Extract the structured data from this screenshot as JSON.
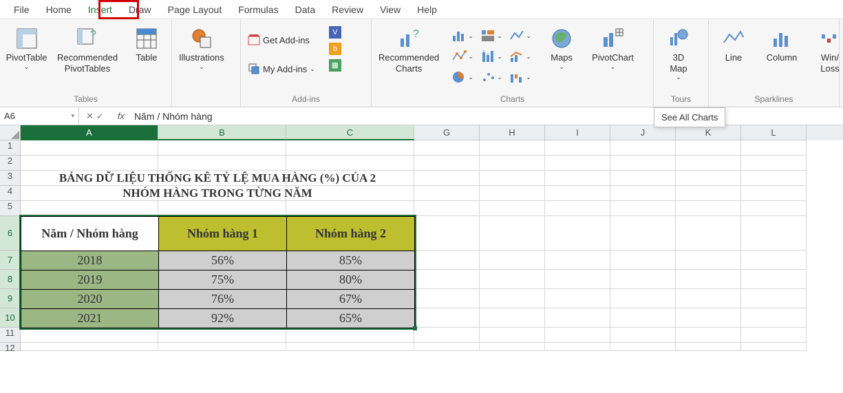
{
  "tabs": {
    "file": "File",
    "home": "Home",
    "insert": "Insert",
    "draw": "Draw",
    "pagelayout": "Page Layout",
    "formulas": "Formulas",
    "data": "Data",
    "review": "Review",
    "view": "View",
    "help": "Help"
  },
  "ribbon": {
    "tables": {
      "pivottable": "PivotTable",
      "recommended_pivots": "Recommended\nPivotTables",
      "table": "Table",
      "label": "Tables"
    },
    "illustrations": {
      "illustrations": "Illustrations",
      "label": ""
    },
    "addins": {
      "get_addins": "Get Add-ins",
      "my_addins": "My Add-ins",
      "label": "Add-ins"
    },
    "charts": {
      "recommended": "Recommended\nCharts",
      "maps": "Maps",
      "pivotchart": "PivotChart",
      "label": "Charts"
    },
    "tours": {
      "map3d": "3D\nMap",
      "label": "Tours"
    },
    "sparklines": {
      "line": "Line",
      "column": "Column",
      "winloss": "Win/\nLoss",
      "label": "Sparklines"
    }
  },
  "tooltip": "See All Charts",
  "name_box": "A6",
  "formula": "Năm / Nhóm hàng",
  "columns": [
    "A",
    "B",
    "C",
    "G",
    "H",
    "I",
    "J",
    "K",
    "L"
  ],
  "rows": [
    "1",
    "2",
    "3",
    "4",
    "5",
    "6",
    "7",
    "8",
    "9",
    "10",
    "11",
    "12"
  ],
  "title_line1": "BẢNG DỮ LIỆU THỐNG KÊ TỶ LỆ MUA HÀNG (%) CỦA 2",
  "title_line2": "NHÓM HÀNG TRONG TỪNG NĂM",
  "table": {
    "headers": {
      "c0": "Năm / Nhóm hàng",
      "c1": "Nhóm hàng 1",
      "c2": "Nhóm hàng 2"
    },
    "rows": [
      {
        "year": "2018",
        "v1": "56%",
        "v2": "85%"
      },
      {
        "year": "2019",
        "v1": "75%",
        "v2": "80%"
      },
      {
        "year": "2020",
        "v1": "76%",
        "v2": "67%"
      },
      {
        "year": "2021",
        "v1": "92%",
        "v2": "65%"
      }
    ]
  }
}
